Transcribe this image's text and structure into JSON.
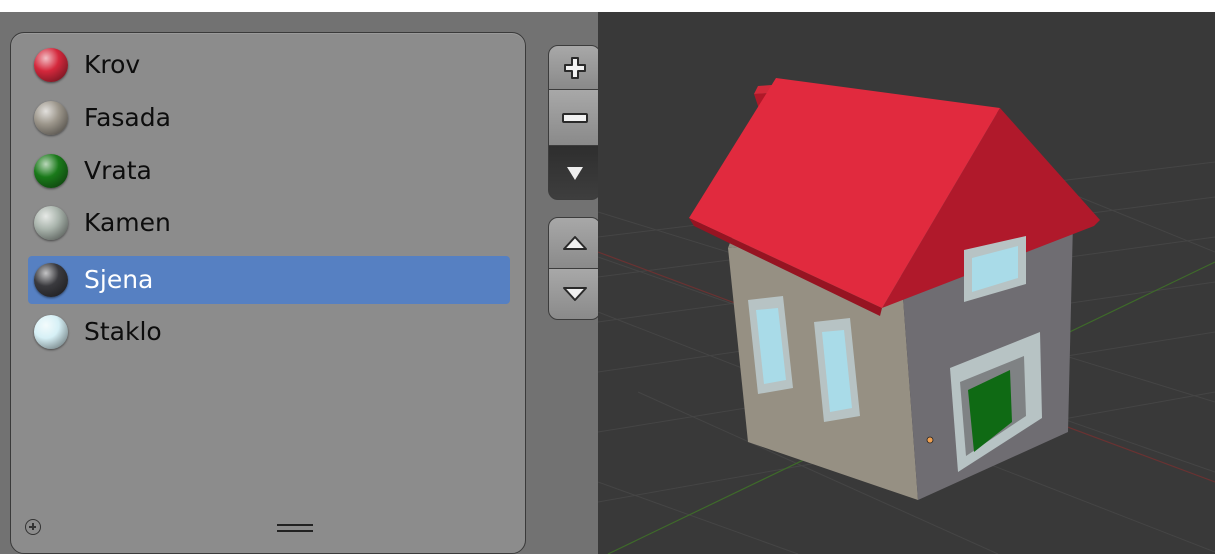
{
  "materials": [
    {
      "name": "Krov",
      "color": "#d4283c",
      "selected": false
    },
    {
      "name": "Fasada",
      "color": "#9d978c",
      "selected": false
    },
    {
      "name": "Vrata",
      "color": "#1a7a1a",
      "selected": false
    },
    {
      "name": "Kamen",
      "color": "#aab5ad",
      "selected": false
    },
    {
      "name": "Sjena",
      "color": "#3a3a3e",
      "selected": true
    },
    {
      "name": "Staklo",
      "color": "#d6f0f6",
      "selected": false
    }
  ],
  "icons": {
    "add_slot": "plus-icon",
    "remove_slot": "minus-icon",
    "specials": "triangle-down-icon",
    "move_up": "arrow-up-icon",
    "move_down": "arrow-down-icon",
    "list_add": "circle-plus-icon",
    "resize": "grip-icon"
  },
  "colors": {
    "panel_bg": "#727272",
    "list_bg": "#8c8c8c",
    "selection": "#5680c2",
    "viewport_bg": "#393939",
    "roof": "#e12a3e",
    "wall_front": "#969083",
    "wall_side": "#6f6d72",
    "door": "#0f6a14",
    "glass": "#a9dbe8",
    "frame": "#b7c3c4"
  }
}
